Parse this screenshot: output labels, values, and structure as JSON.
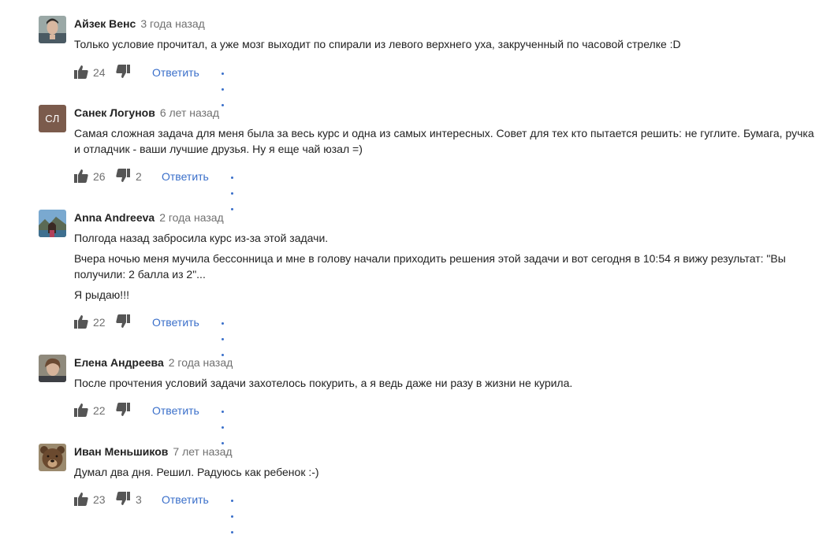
{
  "comments": [
    {
      "author": "Айзек Венс",
      "time": "3 года назад",
      "avatar": "photo-young-man",
      "lines": [
        "Только условие прочитал, а уже мозг выходит по спирали из левого верхнего уха, закрученный по часовой стрелке :D"
      ],
      "likes": "24",
      "dislikes": "",
      "reply_label": "Ответить"
    },
    {
      "author": "Санек Логунов",
      "time": "6 лет назад",
      "avatar_initials": "СЛ",
      "avatar_color": "#7b5b4c",
      "lines": [
        "Самая сложная задача для меня была за весь курс и одна из самых интересных. Совет для тех кто пытается решить: не гуглите. Бумага, ручка и отладчик - ваши лучшие друзья. Ну я еще чай юзал =)"
      ],
      "likes": "26",
      "dislikes": "2",
      "reply_label": "Ответить"
    },
    {
      "author": "Anna Andreeva",
      "time": "2 года назад",
      "avatar": "photo-woman-landscape",
      "lines": [
        "Полгода назад забросила курс из-за этой задачи.",
        "Вчера ночью меня мучила бессонница и мне в голову начали приходить решения этой задачи и вот сегодня в 10:54 я вижу результат: \"Вы получили: 2 балла из 2\"...",
        "Я рыдаю!!!"
      ],
      "likes": "22",
      "dislikes": "",
      "reply_label": "Ответить"
    },
    {
      "author": "Елена Андреева",
      "time": "2 года назад",
      "avatar": "photo-woman",
      "lines": [
        "После прочтения условий задачи захотелось покурить, а я ведь даже ни разу в жизни не курила."
      ],
      "likes": "22",
      "dislikes": "",
      "reply_label": "Ответить"
    },
    {
      "author": "Иван Меньшиков",
      "time": "7 лет назад",
      "avatar": "photo-bear",
      "lines": [
        "Думал два дня. Решил. Радуюсь как ребенок :-)"
      ],
      "likes": "23",
      "dislikes": "3",
      "reply_label": "Ответить"
    }
  ],
  "icons": {
    "like": "thumbs-up-icon",
    "dislike": "thumbs-down-icon",
    "more": "more-dots-icon"
  },
  "colors": {
    "accent": "#3a6fca",
    "muted": "#707070",
    "icon": "#555555"
  }
}
